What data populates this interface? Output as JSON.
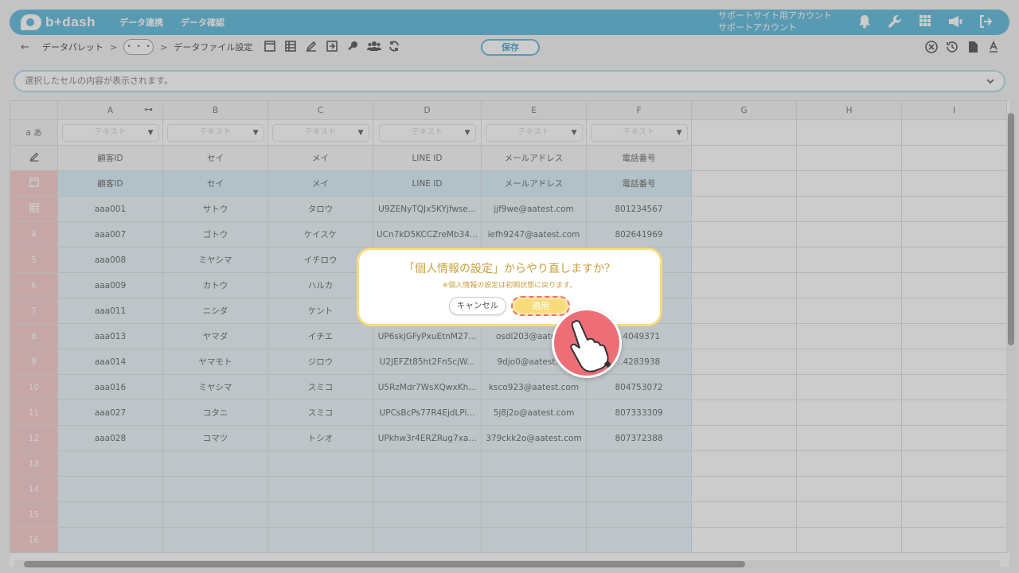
{
  "header": {
    "logo": "b+dash",
    "nav": [
      "データ連携",
      "データ確認"
    ],
    "account_line1": "サポートサイト用アカウント",
    "account_line2": "サポートアカウント"
  },
  "toolbar": {
    "crumb1": "データパレット",
    "crumb_sep": ">",
    "more": "・・・",
    "crumb2": "データファイル設定",
    "save_label": "保存"
  },
  "cellbar": {
    "placeholder": "選択したセルの内容が表示されます。"
  },
  "grid": {
    "columns": [
      "A",
      "B",
      "C",
      "D",
      "E",
      "F",
      "G",
      "H",
      "I"
    ],
    "type_label": "テキスト",
    "type_row_header": "a あ",
    "labels": [
      "顧客ID",
      "セイ",
      "メイ",
      "LINE ID",
      "メールアドレス",
      "電話番号"
    ],
    "meta": [
      "顧客ID",
      "セイ",
      "メイ",
      "LINE ID",
      "メールアドレス",
      "電話番号"
    ],
    "rows": [
      {
        "n": "",
        "cells": [
          "aaa001",
          "サトウ",
          "タロウ",
          "U9ZENyTQJx5KYjfwse...",
          "jjf9we@aatest.com",
          "801234567"
        ]
      },
      {
        "n": "4",
        "cells": [
          "aaa007",
          "ゴトウ",
          "ケイスケ",
          "UCn7kD5KCCZreMb34...",
          "iefh9247@aatest.com",
          "802641969"
        ]
      },
      {
        "n": "5",
        "cells": [
          "aaa008",
          "ミヤシマ",
          "イチロウ",
          "",
          "",
          ""
        ]
      },
      {
        "n": "6",
        "cells": [
          "aaa009",
          "カトウ",
          "ハルカ",
          "",
          "",
          ""
        ]
      },
      {
        "n": "7",
        "cells": [
          "aaa011",
          "ニシダ",
          "ケント",
          "",
          "",
          ""
        ]
      },
      {
        "n": "8",
        "cells": [
          "aaa013",
          "ヤマダ",
          "イチエ",
          "UP6skjGFyPxuEtnM27...",
          "osdl203@aatest...",
          "..4049371"
        ]
      },
      {
        "n": "9",
        "cells": [
          "aaa014",
          "ヤマモト",
          "ジロウ",
          "U2JEFZt85ht2FnScjW...",
          "9djo0@aatest.c...",
          "..4283938"
        ]
      },
      {
        "n": "10",
        "cells": [
          "aaa016",
          "ミヤシマ",
          "スミコ",
          "U5RzMdr7WsXQwxKh...",
          "ksco923@aatest.com",
          "804753072"
        ]
      },
      {
        "n": "11",
        "cells": [
          "aaa027",
          "コタニ",
          "スミコ",
          "UPCsBcPs77R4EjdLPi...",
          "5j8j2o@aatest.com",
          "807333309"
        ]
      },
      {
        "n": "12",
        "cells": [
          "aaa028",
          "コマツ",
          "トシオ",
          "UPkhw3r4ERZRug7xa...",
          "379ckk2o@aatest.com",
          "807372388"
        ]
      }
    ],
    "empty_rows": [
      "13",
      "14",
      "15",
      "16"
    ]
  },
  "dialog": {
    "title": "「個人情報の設定」からやり直しますか？",
    "note": "※個人情報の設定は初期状態に戻ります。",
    "cancel": "キャンセル",
    "apply": "適用"
  },
  "colors": {
    "brand": "#4fb3d9",
    "dialog_border": "#f8dc7c",
    "pointer": "#ee6e77",
    "row_number_bg": "#f6c7c7"
  },
  "icons": {
    "header": [
      "bell-icon",
      "wrench-icon",
      "grid-icon",
      "megaphone-icon",
      "logout-icon"
    ],
    "toolbar": [
      "window-icon",
      "table-icon",
      "edit-icon",
      "import-icon",
      "key-icon",
      "users-icon",
      "refresh-icon"
    ],
    "toolbar_right": [
      "close-circle-icon",
      "history-icon",
      "file-icon",
      "text-icon"
    ]
  }
}
